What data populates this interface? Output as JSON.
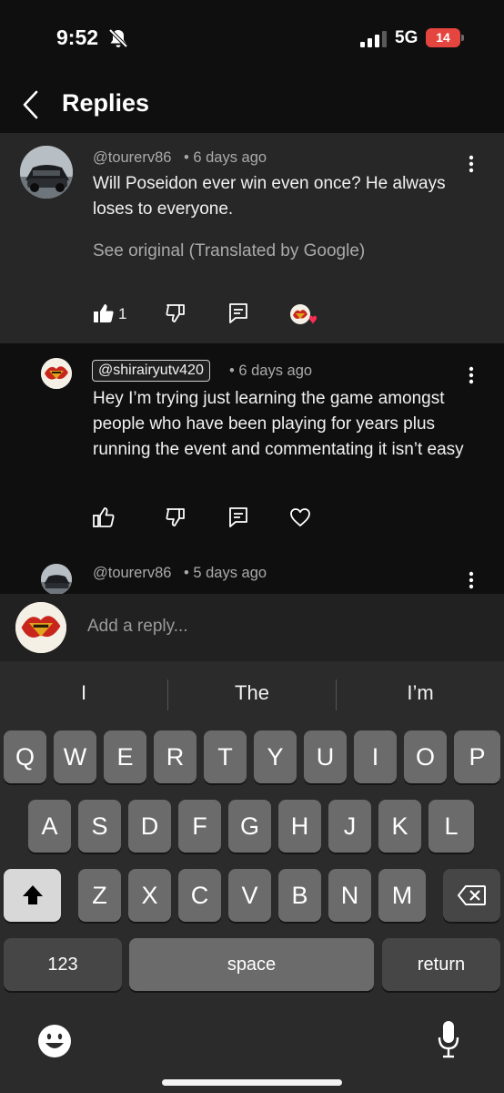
{
  "status_bar": {
    "time": "9:52",
    "network": "5G",
    "battery": "14"
  },
  "header": {
    "title": "Replies"
  },
  "parent_comment": {
    "handle": "@tourerv86",
    "age": "• 6 days ago",
    "text": "Will Poseidon ever win even once? He always loses to everyone.",
    "see_original": "See original (Translated by Google)",
    "like_count": "1"
  },
  "replies": [
    {
      "handle": "@shirairyutv420",
      "age": "• 6 days ago",
      "text": "Hey I’m trying just learning the game amongst people who have been playing for years plus running the event and commentating it isn’t easy"
    },
    {
      "handle": "@tourerv86",
      "age": "• 5 days ago"
    }
  ],
  "reply_input": {
    "placeholder": "Add a reply..."
  },
  "keyboard": {
    "suggestions": [
      "I",
      "The",
      "I’m"
    ],
    "row1": [
      "Q",
      "W",
      "E",
      "R",
      "T",
      "Y",
      "U",
      "I",
      "O",
      "P"
    ],
    "row2": [
      "A",
      "S",
      "D",
      "F",
      "G",
      "H",
      "J",
      "K",
      "L"
    ],
    "row3": [
      "Z",
      "X",
      "C",
      "V",
      "B",
      "N",
      "M"
    ],
    "numbers_label": "123",
    "space_label": "space",
    "return_label": "return"
  },
  "colors": {
    "background": "#0f0f0f",
    "highlight": "#272727",
    "heart": "#ff2d55",
    "battery": "#e5453f"
  }
}
